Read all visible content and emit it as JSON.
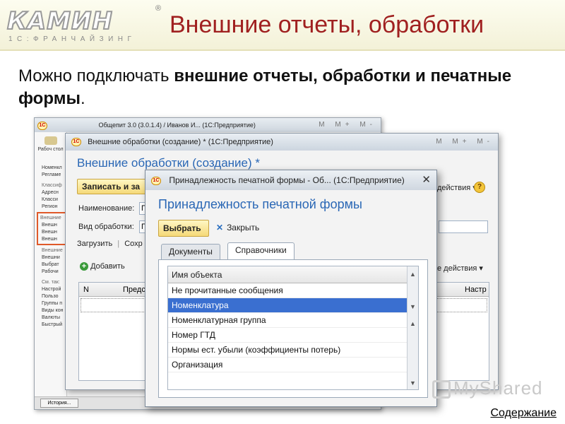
{
  "logo": {
    "name": "КАМИН",
    "registered": "®",
    "subtitle": "1С:ФРАНЧАЙЗИНГ"
  },
  "slide": {
    "title": "Внешние отчеты, обработки",
    "intro_plain": "Можно подключать ",
    "intro_bold": "внешние отчеты, обработки и печатные формы",
    "intro_end": "."
  },
  "bg_window": {
    "title": "Общепит 3.0 (3.0.1.4) / Иванов И...  (1С:Предприятие)",
    "toolbar_icons": "M M+ M-",
    "left_panel": {
      "desktop_label": "Рабоч стол",
      "items_top": [
        "Номенкл",
        "Регламе"
      ],
      "group1": "Классиф",
      "group1_items": [
        "Адресн",
        "Класси",
        "Регион"
      ],
      "group2": "Внешние",
      "group2_items": [
        "Внешн",
        "Внешн",
        "Внешн"
      ],
      "group3": "Внешние",
      "group3_items": [
        "Внешни",
        "Выбрат",
        "Рабочи"
      ],
      "group4": "См. так:",
      "group4_items": [
        "Настрой",
        "Пользо",
        "Группы п",
        "Виды кон",
        "Валюты",
        "Быстрый"
      ]
    },
    "status": {
      "history_button": "История..."
    }
  },
  "mid_window": {
    "title": "Внешние обработки (создание) * (1С:Предприятие)",
    "toolbar_icons": "M M+ M-",
    "header": "Внешние обработки (создание) *",
    "save_button": "Записать и за",
    "actions_menu": "действия ▾",
    "name_label": "Наименование:",
    "name_value": "П",
    "type_label": "Вид обработки:",
    "type_value": "П",
    "tab_load": "Загрузить",
    "tab_other": "Сохр",
    "add_button": "Добавить",
    "more_actions": "е действия ▾",
    "col_n": "N",
    "col_pred": "Предс",
    "col_settings": "Настр"
  },
  "dialog": {
    "title": "Принадлежность печатной формы - Об...  (1С:Предприятие)",
    "close_symbol": "✕",
    "header": "Принадлежность печатной формы",
    "choose_button": "Выбрать",
    "close_button": "Закрыть",
    "tabs": [
      {
        "label": "Документы",
        "active": false
      },
      {
        "label": "Справочники",
        "active": true
      }
    ],
    "list_header": "Имя объекта",
    "rows": [
      {
        "label": "Не прочитанные сообщения",
        "selected": false
      },
      {
        "label": "Номенклатура",
        "selected": true
      },
      {
        "label": "Номенклатурная группа",
        "selected": false
      },
      {
        "label": "Номер ГТД",
        "selected": false
      },
      {
        "label": "Нормы ест. убыли (коэффициенты потерь)",
        "selected": false
      },
      {
        "label": "Организация",
        "selected": false
      }
    ]
  },
  "watermark": "MyShared",
  "footer": {
    "toc_link": "Содержание"
  },
  "colors": {
    "title_red": "#a02020",
    "form_blue": "#2a67b5",
    "selection": "#3a6fd0",
    "highlight_border": "#e05a2a"
  }
}
